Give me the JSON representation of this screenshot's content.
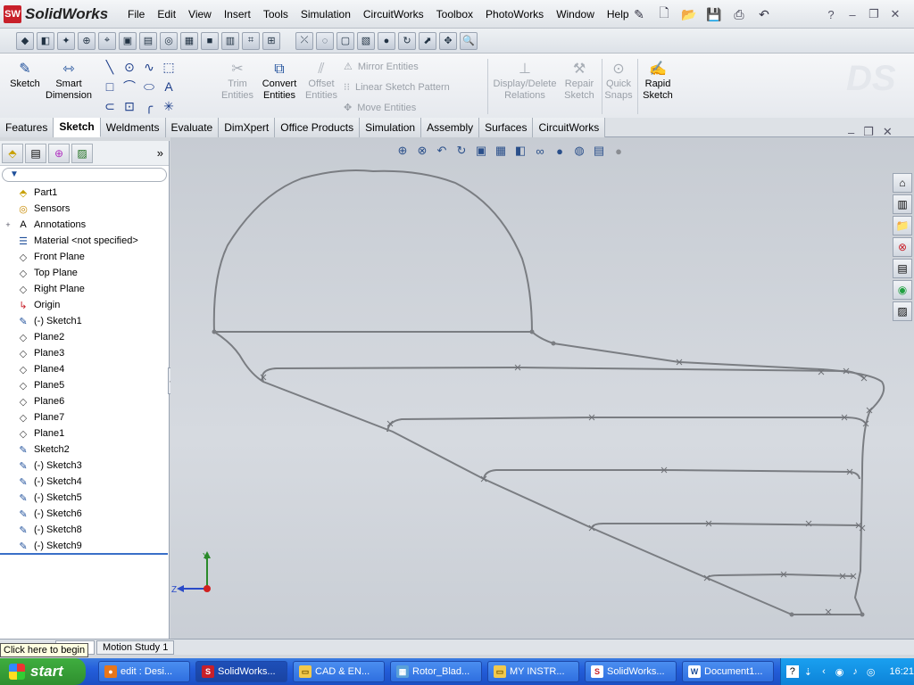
{
  "app": {
    "logo_badge": "SW",
    "name": "SolidWorks"
  },
  "menu": [
    "File",
    "Edit",
    "View",
    "Insert",
    "Tools",
    "Simulation",
    "CircuitWorks",
    "Toolbox",
    "PhotoWorks",
    "Window",
    "Help"
  ],
  "command_manager": {
    "sketch": "Sketch",
    "smart_dimension": "Smart Dimension",
    "trim_entities": "Trim Entities",
    "convert_entities": "Convert Entities",
    "offset_entities": "Offset Entities",
    "mirror_entities": "Mirror Entities",
    "linear_sketch_pattern": "Linear Sketch Pattern",
    "move_entities": "Move Entities",
    "display_delete_relations": "Display/Delete Relations",
    "repair_sketch": "Repair Sketch",
    "quick_snaps": "Quick Snaps",
    "rapid_sketch": "Rapid Sketch"
  },
  "tabs": [
    "Features",
    "Sketch",
    "Weldments",
    "Evaluate",
    "DimXpert",
    "Office Products",
    "Simulation",
    "Assembly",
    "Surfaces",
    "CircuitWorks"
  ],
  "active_tab": "Sketch",
  "feature_tree": [
    {
      "label": "Part1",
      "icon": "part-icon",
      "expand": ""
    },
    {
      "label": "Sensors",
      "icon": "sensors-icon",
      "expand": ""
    },
    {
      "label": "Annotations",
      "icon": "annotations-icon",
      "expand": "+"
    },
    {
      "label": "Material <not specified>",
      "icon": "material-icon",
      "expand": ""
    },
    {
      "label": "Front Plane",
      "icon": "plane-icon",
      "expand": ""
    },
    {
      "label": "Top Plane",
      "icon": "plane-icon",
      "expand": ""
    },
    {
      "label": "Right Plane",
      "icon": "plane-icon",
      "expand": ""
    },
    {
      "label": "Origin",
      "icon": "origin-icon",
      "expand": ""
    },
    {
      "label": "(-) Sketch1",
      "icon": "sketch-icon",
      "expand": ""
    },
    {
      "label": "Plane2",
      "icon": "plane-icon",
      "expand": ""
    },
    {
      "label": "Plane3",
      "icon": "plane-icon",
      "expand": ""
    },
    {
      "label": "Plane4",
      "icon": "plane-icon",
      "expand": ""
    },
    {
      "label": "Plane5",
      "icon": "plane-icon",
      "expand": ""
    },
    {
      "label": "Plane6",
      "icon": "plane-icon",
      "expand": ""
    },
    {
      "label": "Plane7",
      "icon": "plane-icon",
      "expand": ""
    },
    {
      "label": "Plane1",
      "icon": "plane-icon",
      "expand": ""
    },
    {
      "label": "Sketch2",
      "icon": "sketch-icon",
      "expand": ""
    },
    {
      "label": "(-) Sketch3",
      "icon": "sketch-icon",
      "expand": ""
    },
    {
      "label": "(-) Sketch4",
      "icon": "sketch-icon",
      "expand": ""
    },
    {
      "label": "(-) Sketch5",
      "icon": "sketch-icon",
      "expand": ""
    },
    {
      "label": "(-) Sketch6",
      "icon": "sketch-icon",
      "expand": ""
    },
    {
      "label": "(-) Sketch8",
      "icon": "sketch-icon",
      "expand": ""
    },
    {
      "label": "(-) Sketch9",
      "icon": "sketch-icon",
      "expand": ""
    }
  ],
  "triad": {
    "y": "Y",
    "z": "Z"
  },
  "bottom_tabs": [
    "Model",
    "Motion Study 1"
  ],
  "tooltip": "Click here to begin",
  "taskbar": {
    "start": "start",
    "items": [
      {
        "label": "edit : Desi...",
        "icon": "firefox-icon"
      },
      {
        "label": "SolidWorks...",
        "icon": "solidworks-icon"
      },
      {
        "label": "CAD & EN...",
        "icon": "folder-icon"
      },
      {
        "label": "Rotor_Blad...",
        "icon": "image-icon"
      },
      {
        "label": "MY INSTR...",
        "icon": "folder-icon"
      },
      {
        "label": "SolidWorks...",
        "icon": "solidworks-doc-icon"
      },
      {
        "label": "Document1...",
        "icon": "word-icon"
      }
    ],
    "clock": "16:21"
  },
  "colors": {
    "sketch_line": "#7a7d82",
    "accent_blue": "#1d4e9a",
    "sw_red": "#c8202a"
  }
}
